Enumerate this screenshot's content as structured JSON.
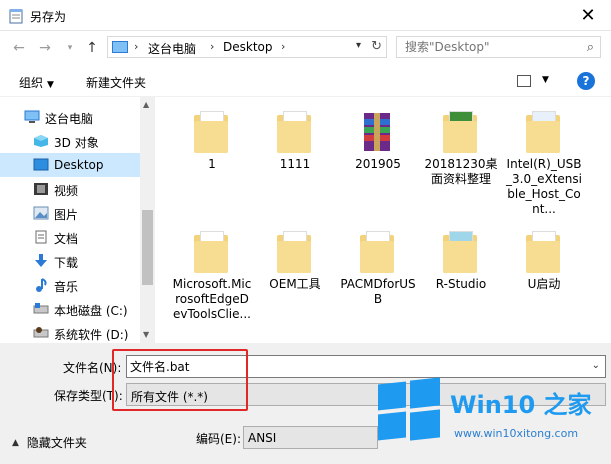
{
  "window": {
    "title": "另存为"
  },
  "address": {
    "crumbs": [
      "这台电脑",
      "Desktop"
    ],
    "search_placeholder": "搜索\"Desktop\""
  },
  "toolbar": {
    "organize": "组织",
    "new_folder": "新建文件夹"
  },
  "sidebar": {
    "items": [
      {
        "label": "这台电脑",
        "icon": "pc-icon"
      },
      {
        "label": "3D 对象",
        "icon": "3d-objects-icon"
      },
      {
        "label": "Desktop",
        "icon": "desktop-icon",
        "selected": true
      },
      {
        "label": "视频",
        "icon": "video-icon"
      },
      {
        "label": "图片",
        "icon": "pictures-icon"
      },
      {
        "label": "文档",
        "icon": "documents-icon"
      },
      {
        "label": "下载",
        "icon": "downloads-icon"
      },
      {
        "label": "音乐",
        "icon": "music-icon"
      },
      {
        "label": "本地磁盘 (C:)",
        "icon": "drive-icon"
      },
      {
        "label": "系统软件 (D:)",
        "icon": "drive-icon"
      }
    ]
  },
  "files": [
    {
      "name": "1",
      "icon": "folder-icon"
    },
    {
      "name": "1111",
      "icon": "folder-icon"
    },
    {
      "name": "201905",
      "icon": "archive-icon"
    },
    {
      "name": "20181230桌面资料整理",
      "icon": "folder-icon"
    },
    {
      "name": "Intel(R)_USB_3.0_eXtensible_Host_Cont...",
      "icon": "folder-icon"
    },
    {
      "name": "Microsoft.MicrosoftEdgeDevToolsClie...",
      "icon": "folder-icon"
    },
    {
      "name": "OEM工具",
      "icon": "folder-icon"
    },
    {
      "name": "PACMDforUSB",
      "icon": "folder-icon"
    },
    {
      "name": "R-Studio",
      "icon": "folder-icon"
    },
    {
      "name": "U启动",
      "icon": "folder-icon"
    }
  ],
  "save": {
    "filename_label": "文件名(N):",
    "filename_value": "文件名.bat",
    "filetype_label": "保存类型(T):",
    "filetype_value": "所有文件  (*.*)",
    "encoding_label": "编码(E):",
    "encoding_value": "ANSI",
    "hide_folders": "隐藏文件夹"
  },
  "watermark": {
    "title": "Win10 之家",
    "url": "www.win10xitong.com"
  },
  "colors": {
    "accent": "#1e9af0",
    "highlight": "#e02828",
    "selected_bg": "#cce8ff"
  }
}
